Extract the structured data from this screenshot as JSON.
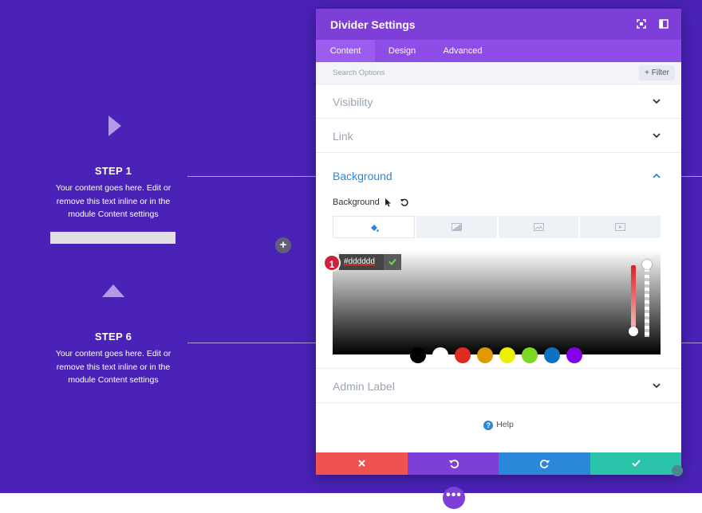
{
  "colors": {
    "canvas_bg": "#4a22b8",
    "modal_header": "#7d3fd8",
    "tab_bar": "#8d4de6",
    "accent_blue": "#2b87da",
    "footer": [
      "#ef5350",
      "#7d3fd8",
      "#2b87da",
      "#29c4a9"
    ]
  },
  "page": {
    "steps": [
      {
        "icon": "triangle-right-icon",
        "title": "STEP 1",
        "text_lines": [
          "Your content goes here. Edit or",
          "remove this text inline or in the",
          "module Content settings"
        ]
      },
      {
        "icon": "triangle-up-icon",
        "title": "STEP 6",
        "text_lines": [
          "Your content goes here. Edit or",
          "remove this text inline or in the",
          "module Content settings"
        ]
      }
    ],
    "add_module_symbol": "+",
    "more_options_symbol": "•••"
  },
  "modal": {
    "title": "Divider Settings",
    "header_icons": [
      "fullscreen-icon",
      "sidebar-toggle-icon"
    ],
    "tabs": [
      {
        "label": "Content",
        "active": true
      },
      {
        "label": "Design",
        "active": false
      },
      {
        "label": "Advanced",
        "active": false
      }
    ],
    "search_placeholder": "Search Options",
    "filter_label": "+ Filter",
    "sections": {
      "visibility": "Visibility",
      "link": "Link",
      "background": "Background",
      "admin_label": "Admin Label"
    },
    "background": {
      "field_label": "Background",
      "field_icons": [
        "cursor-icon",
        "reset-icon"
      ],
      "type_tabs": [
        "color-fill-icon",
        "gradient-icon",
        "image-icon",
        "video-icon"
      ],
      "active_type_tab": 0,
      "hex_value": "#dddddd",
      "badge_number": "1",
      "swatches": [
        "#000000",
        "#ffffff",
        "#e02b20",
        "#e09900",
        "#edf000",
        "#7cda24",
        "#0c71c3",
        "#8300e9"
      ]
    },
    "help_label": "Help",
    "footer_buttons": [
      "discard-icon",
      "undo-icon",
      "redo-icon",
      "save-check-icon"
    ]
  }
}
